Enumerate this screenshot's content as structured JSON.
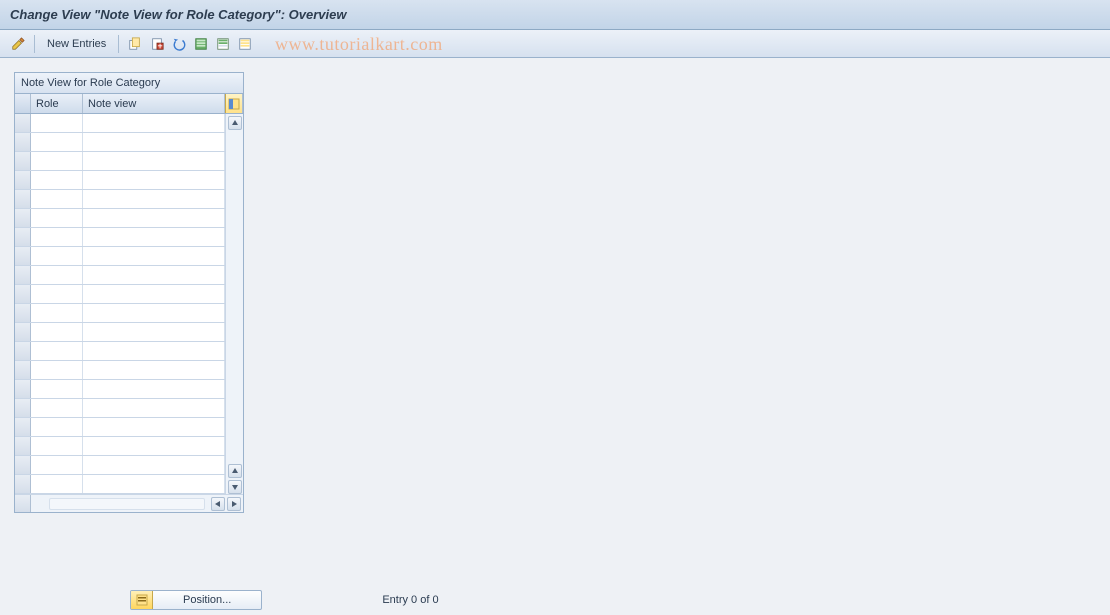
{
  "header": {
    "title": "Change View \"Note View for Role Category\": Overview"
  },
  "toolbar": {
    "new_entries_label": "New Entries",
    "icons": {
      "toggle": "toggle-display-change-icon",
      "copy": "copy-as-icon",
      "delete": "delete-icon",
      "undo": "undo-change-icon",
      "select_all": "select-all-icon",
      "select_block": "select-block-icon",
      "deselect_all": "deselect-all-icon"
    }
  },
  "watermark": "www.tutorialkart.com",
  "table": {
    "title": "Note View for Role Category",
    "columns": {
      "role": "Role",
      "note": "Note view"
    },
    "row_count": 20
  },
  "footer": {
    "position_label": "Position...",
    "entry_status": "Entry 0 of 0"
  }
}
